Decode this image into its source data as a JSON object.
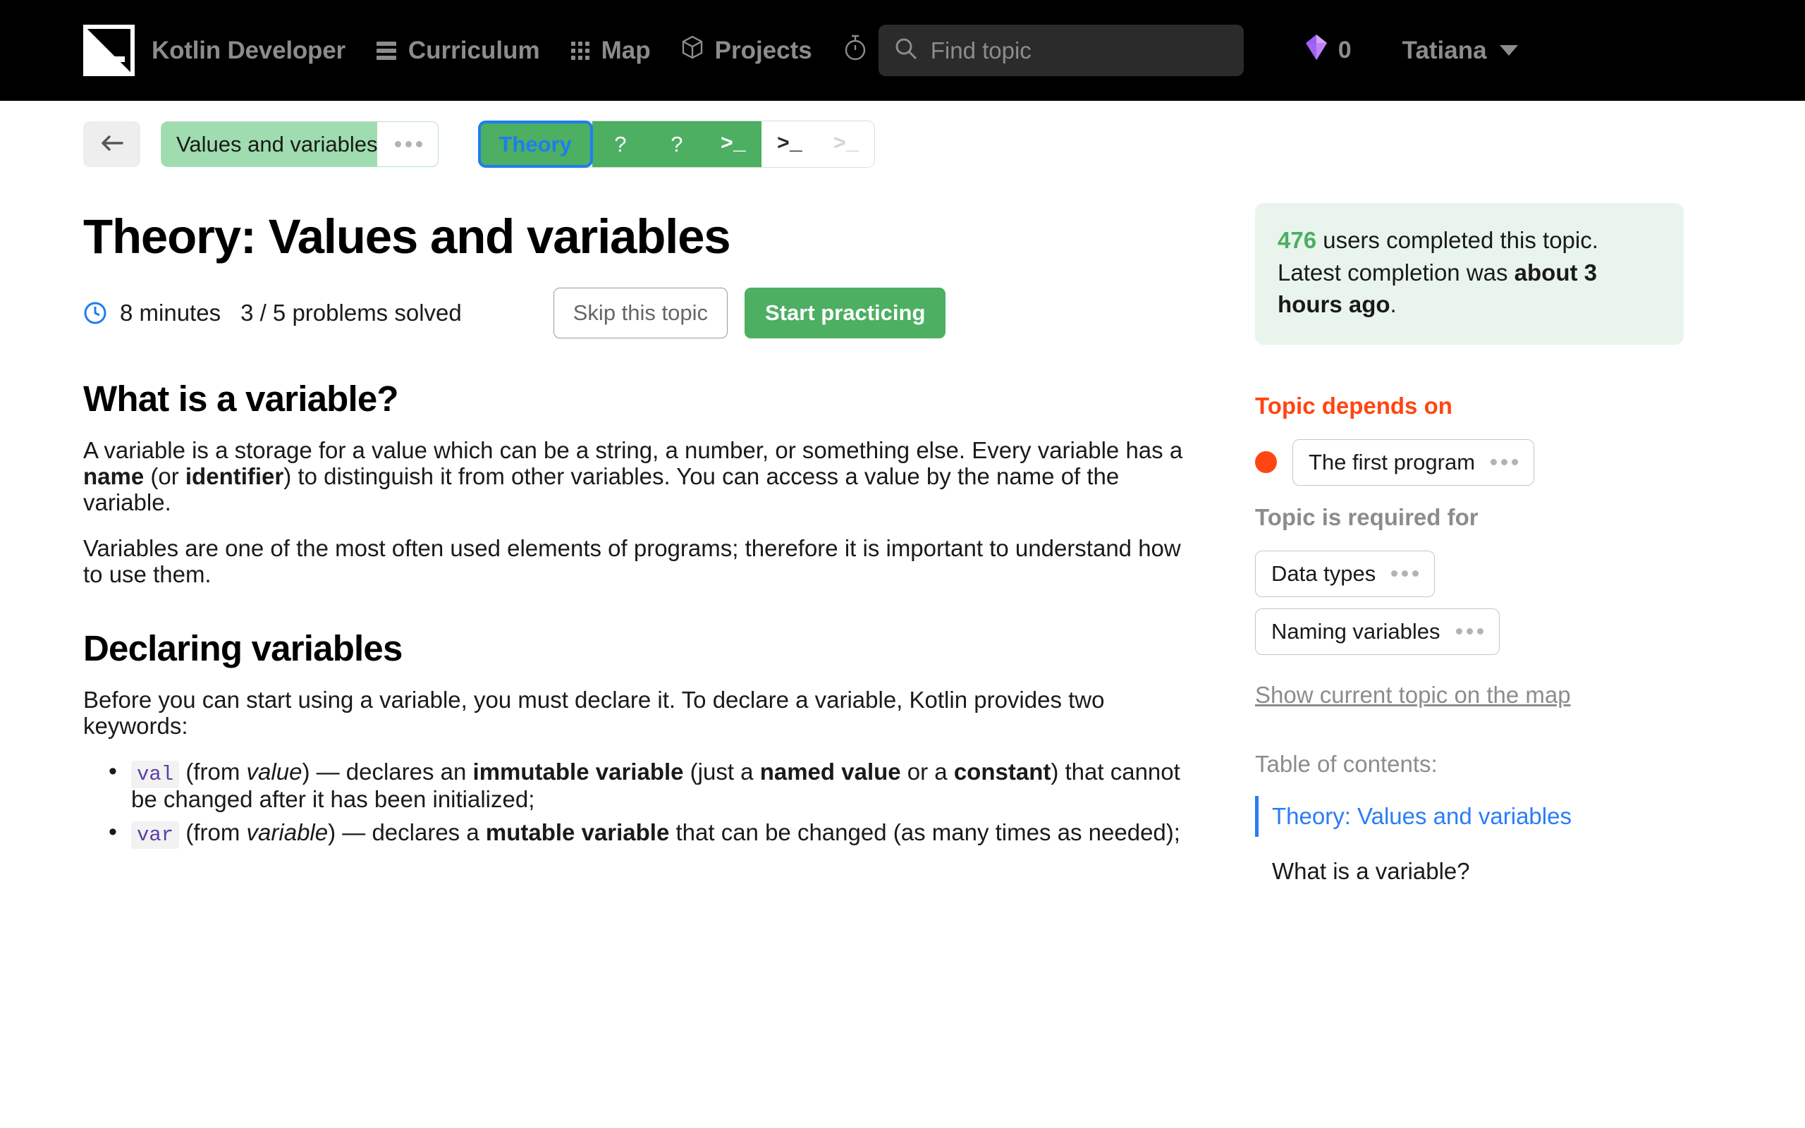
{
  "topnav": {
    "logo_icon": "hyperskill-logo-icon",
    "brand": "Kotlin Developer",
    "items": [
      {
        "label": "Curriculum",
        "icon": "burger-menu-icon"
      },
      {
        "label": "Map",
        "icon": "grid-dots-icon"
      },
      {
        "label": "Projects",
        "icon": "cube-icon"
      }
    ],
    "timer_icon": "stopwatch-icon",
    "search": {
      "icon": "search-icon",
      "placeholder": "Find topic",
      "value": ""
    },
    "gems": {
      "icon": "gem-icon",
      "count": "0"
    },
    "user": {
      "name": "Tatiana",
      "caret_icon": "caret-down-icon"
    }
  },
  "crumbbar": {
    "back_icon": "arrow-left-icon",
    "topic_chip": {
      "label": "Values and variables",
      "menu_icon": "ellipsis-icon",
      "progress_percent": 78
    },
    "steps": [
      {
        "label": "Theory",
        "state": "current",
        "icon": ""
      },
      {
        "label": "?",
        "state": "solved",
        "icon": "question-icon"
      },
      {
        "label": "?",
        "state": "solved",
        "icon": "question-icon"
      },
      {
        "label": ">_",
        "state": "solved",
        "icon": "terminal-icon"
      },
      {
        "label": ">_",
        "state": "unsolved",
        "icon": "terminal-icon"
      },
      {
        "label": ">_",
        "state": "dim",
        "icon": "terminal-icon"
      }
    ]
  },
  "main": {
    "title": "Theory: Values and variables",
    "clock_icon": "clock-icon",
    "duration": "8 minutes",
    "problems": "3 / 5 problems solved",
    "skip_label": "Skip this topic",
    "practice_label": "Start practicing",
    "sections": [
      {
        "heading": "What is a variable?",
        "paragraphs": [
          "A variable is a storage for a value which can be a string, a number, or something else. Every variable has a name (or identifier) to distinguish it from other variables. You can access a value by the name of the variable.",
          "Variables are one of the most often used elements of programs; therefore it is important to understand how to use them."
        ]
      },
      {
        "heading": "Declaring variables",
        "paragraphs": [
          "Before you can start using a variable, you must declare it. To declare a variable, Kotlin provides two keywords:"
        ],
        "bullets": [
          {
            "code": "val",
            "from": "value",
            "text": " (from value) — declares an immutable variable (just a named value or a constant) that cannot be changed after it has been initialized;"
          },
          {
            "code": "var",
            "from": "variable",
            "text": " (from variable) — declares a mutable variable that can be changed (as many times as needed);"
          }
        ]
      }
    ]
  },
  "aside": {
    "stat": {
      "count": "476",
      "text_before": " users completed this topic. Latest completion was ",
      "highlight": "about 3 hours ago",
      "text_after": "."
    },
    "depends_heading": "Topic depends on",
    "depends": [
      {
        "label": "The first program",
        "menu_icon": "ellipsis-icon",
        "status": "locked"
      }
    ],
    "required_heading": "Topic is required for",
    "required": [
      {
        "label": "Data types",
        "menu_icon": "ellipsis-icon"
      },
      {
        "label": "Naming variables",
        "menu_icon": "ellipsis-icon"
      }
    ],
    "map_link": "Show current topic on the map",
    "toc_title": "Table of contents:",
    "toc": [
      {
        "label": "Theory: Values and variables",
        "active": true
      },
      {
        "label": "What is a variable?",
        "active": false
      }
    ]
  }
}
